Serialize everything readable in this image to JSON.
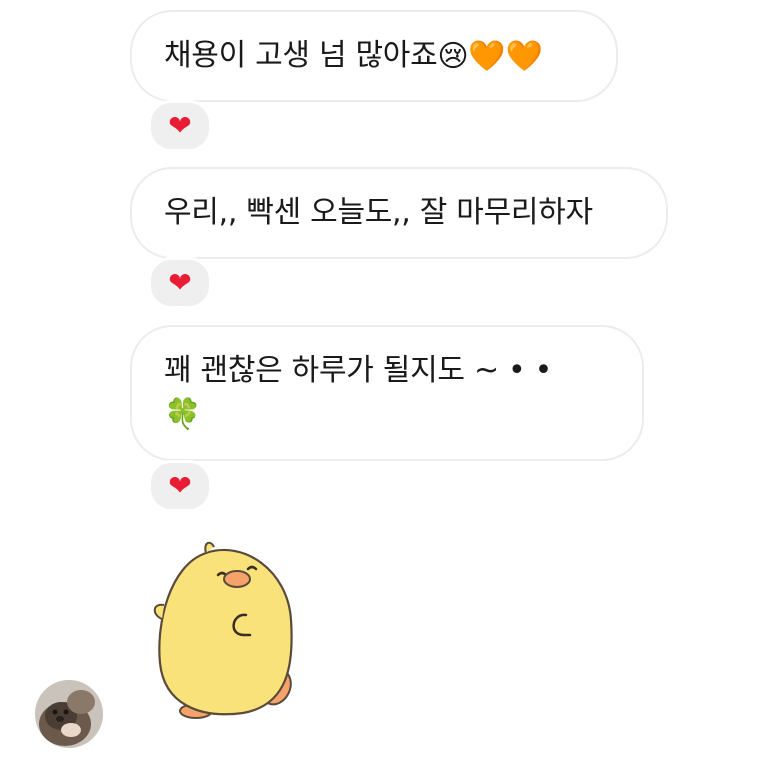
{
  "messages": [
    {
      "text": "채용이 고생 넘 많아죠",
      "emoji": "😢🧡🧡",
      "reaction": "❤"
    },
    {
      "text": "우리,, 빡센 오늘도,, 잘 마무리하자",
      "reaction": "❤"
    },
    {
      "text": "꽤 괜찮은 하루가 될지도 ~ • •",
      "emoji_line": "🍀",
      "reaction": "❤"
    }
  ],
  "sticker": {
    "icon": "yellow-chick-sticker"
  },
  "avatar": {
    "icon": "otter-avatar"
  },
  "colors": {
    "bubble_border": "#ececec",
    "reaction_bg": "#efefef",
    "heart": "#e81d33",
    "chick_body": "#f9e27a",
    "chick_beak": "#f5a36b"
  }
}
